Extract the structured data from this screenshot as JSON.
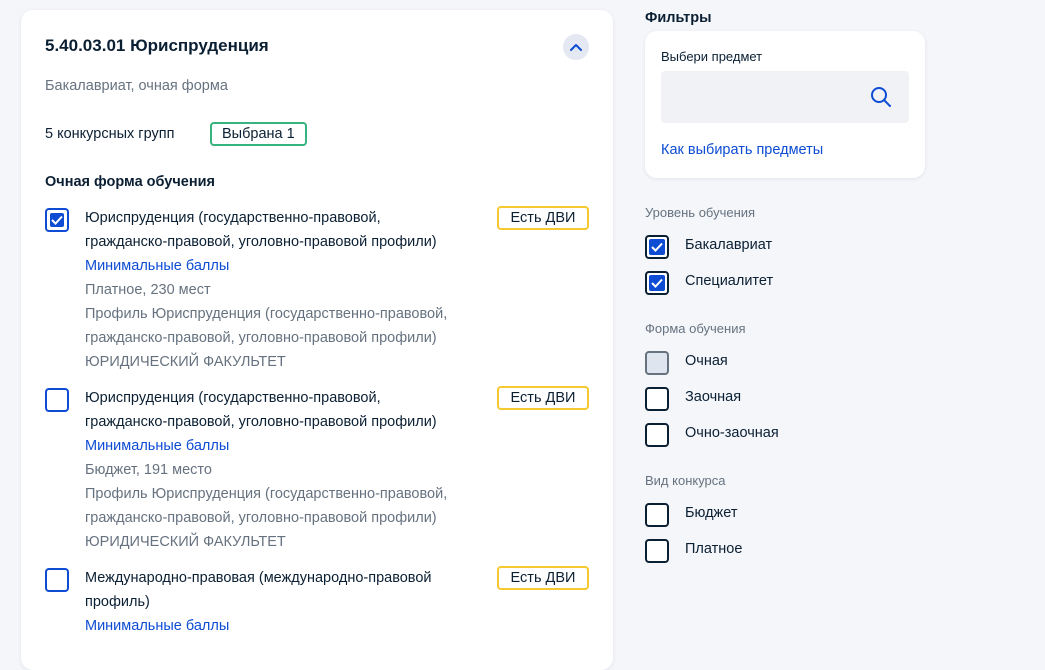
{
  "direction": {
    "title": "5.40.03.01 Юриспруденция",
    "subtitle": "Бакалавриат, очная форма",
    "groups_count": "5 конкурсных групп",
    "selected_badge": "Выбрана 1",
    "section_title": "Очная форма обучения",
    "programs": [
      {
        "checked": true,
        "name_line1": "Юриспруденция (государственно-правовой,",
        "name_line2": "гражданско-правовой, уголовно-правовой профили)",
        "link": "Минимальные баллы",
        "places": "Платное, 230 мест",
        "profile_line1": "Профиль Юриспруденция (государственно-правовой,",
        "profile_line2": "гражданско-правовой, уголовно-правовой профили)",
        "faculty": "ЮРИДИЧЕСКИЙ ФАКУЛЬТЕТ",
        "badge": "Есть ДВИ"
      },
      {
        "checked": false,
        "name_line1": "Юриспруденция (государственно-правовой,",
        "name_line2": "гражданско-правовой, уголовно-правовой профили)",
        "link": "Минимальные баллы",
        "places": "Бюджет, 191 место",
        "profile_line1": "Профиль Юриспруденция (государственно-правовой,",
        "profile_line2": "гражданско-правовой, уголовно-правовой профили)",
        "faculty": "ЮРИДИЧЕСКИЙ ФАКУЛЬТЕТ",
        "badge": "Есть ДВИ"
      },
      {
        "checked": false,
        "name_line1": "Международно-правовая (международно-правовой",
        "name_line2": "профиль)",
        "link": "Минимальные баллы",
        "badge": "Есть ДВИ"
      }
    ]
  },
  "filters": {
    "heading": "Фильтры",
    "subject": {
      "label": "Выбери предмет",
      "value": "",
      "link": "Как выбирать предметы"
    },
    "level": {
      "title": "Уровень обучения",
      "options": [
        {
          "label": "Бакалавриат",
          "checked": true
        },
        {
          "label": "Специалитет",
          "checked": true
        }
      ]
    },
    "form": {
      "title": "Форма обучения",
      "options": [
        {
          "label": "Очная",
          "checked": false
        },
        {
          "label": "Заочная",
          "checked": false
        },
        {
          "label": "Очно-заочная",
          "checked": false
        }
      ]
    },
    "contest": {
      "title": "Вид конкурса",
      "options": [
        {
          "label": "Бюджет",
          "checked": false
        },
        {
          "label": "Платное",
          "checked": false
        }
      ]
    }
  },
  "colors": {
    "accent": "#0d4cd3",
    "badge_green": "#36b37e",
    "badge_yellow": "#f5c932",
    "muted_text": "#66727f"
  }
}
